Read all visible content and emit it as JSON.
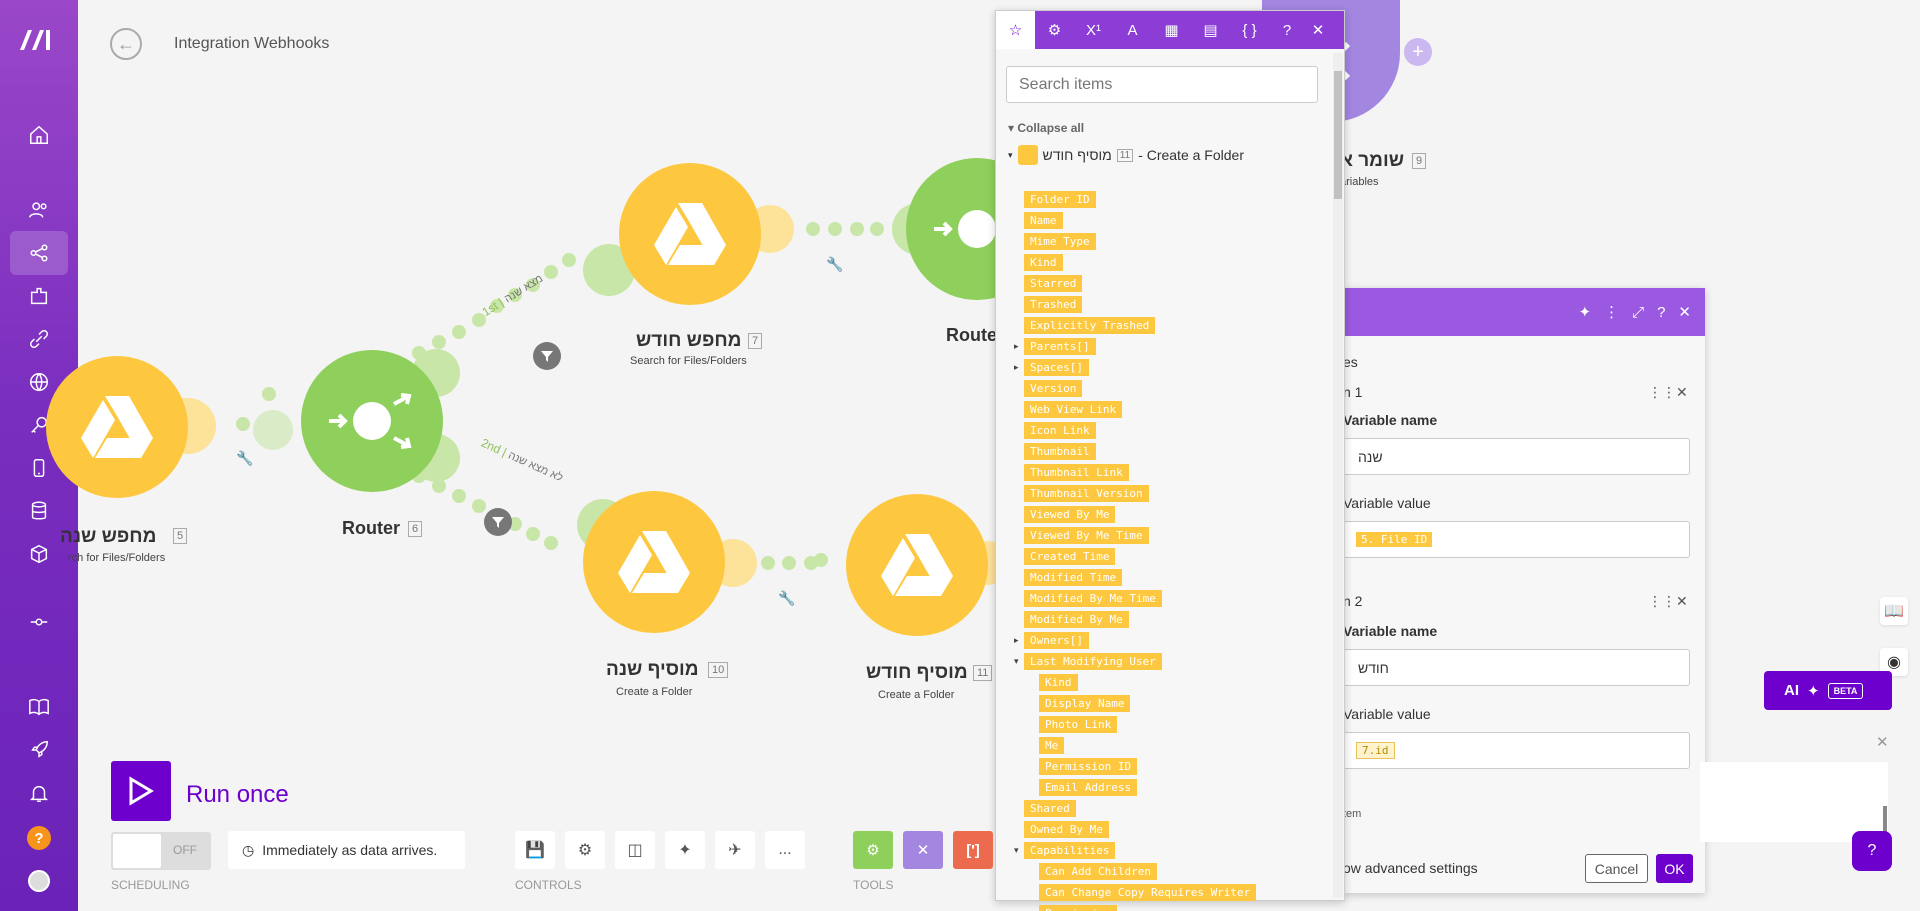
{
  "header": {
    "title": "Integration Webhooks"
  },
  "sidebar": {
    "items": [
      "home-icon",
      "team-icon",
      "scenarios-icon",
      "templates-icon",
      "connections-icon",
      "webhooks-icon",
      "keys-icon",
      "devices-icon",
      "datastores-icon",
      "datastructures-icon",
      "flow-control-icon",
      "docs-icon",
      "rocket-icon",
      "bell-icon"
    ],
    "help_label": "?"
  },
  "canvas": {
    "nodes": [
      {
        "id": "search-year",
        "label": "מחפש שנה",
        "num": "5",
        "sub": "rch for Files/Folders"
      },
      {
        "id": "router-1",
        "label": "Router",
        "num": "6"
      },
      {
        "id": "search-month",
        "label": "מחפש חודש",
        "num": "7",
        "sub": "Search for Files/Folders"
      },
      {
        "id": "router-2",
        "label": "Route"
      },
      {
        "id": "add-year",
        "label": "מוסיף שנה",
        "num": "10",
        "sub": "Create a Folder"
      },
      {
        "id": "add-month",
        "label": "מוסיף חודש",
        "num": "11",
        "sub": "Create a Folder"
      },
      {
        "id": "set-vars",
        "label": "שומר א",
        "num": "9",
        "sub": "ariables"
      }
    ],
    "routes": [
      {
        "order": "1st",
        "label": "מצא שנה"
      },
      {
        "order": "2nd",
        "label": "לא מצא שנה"
      }
    ]
  },
  "bottom": {
    "run_label": "Run once",
    "toggle_label": "OFF",
    "schedule_text": "Immediately as data arrives.",
    "scheduling_label": "SCHEDULING",
    "controls_label": "CONTROLS",
    "tools_label": "TOOLS",
    "more_label": "...",
    "tool_text_label": "[']"
  },
  "mapper": {
    "search_placeholder": "Search items",
    "collapse_all": "Collapse all",
    "root_label": "מוסיף חודש",
    "root_num": "11",
    "root_suffix": "- Create a Folder",
    "items": [
      {
        "label": "Folder ID",
        "indent": 0
      },
      {
        "label": "Name",
        "indent": 0
      },
      {
        "label": "Mime Type",
        "indent": 0
      },
      {
        "label": "Kind",
        "indent": 0
      },
      {
        "label": "Starred",
        "indent": 0
      },
      {
        "label": "Trashed",
        "indent": 0
      },
      {
        "label": "Explicitly Trashed",
        "indent": 0
      },
      {
        "label": "Parents[]",
        "indent": 0,
        "caret": "right"
      },
      {
        "label": "Spaces[]",
        "indent": 0,
        "caret": "right"
      },
      {
        "label": "Version",
        "indent": 0
      },
      {
        "label": "Web View Link",
        "indent": 0
      },
      {
        "label": "Icon Link",
        "indent": 0
      },
      {
        "label": "Thumbnail",
        "indent": 0
      },
      {
        "label": "Thumbnail Link",
        "indent": 0
      },
      {
        "label": "Thumbnail Version",
        "indent": 0
      },
      {
        "label": "Viewed By Me",
        "indent": 0
      },
      {
        "label": "Viewed By Me Time",
        "indent": 0
      },
      {
        "label": "Created Time",
        "indent": 0
      },
      {
        "label": "Modified Time",
        "indent": 0
      },
      {
        "label": "Modified By Me Time",
        "indent": 0
      },
      {
        "label": "Modified By Me",
        "indent": 0
      },
      {
        "label": "Owners[]",
        "indent": 0,
        "caret": "right"
      },
      {
        "label": "Last Modifying User",
        "indent": 0,
        "caret": "down"
      },
      {
        "label": "Kind",
        "indent": 1
      },
      {
        "label": "Display Name",
        "indent": 1
      },
      {
        "label": "Photo Link",
        "indent": 1
      },
      {
        "label": "Me",
        "indent": 1
      },
      {
        "label": "Permission ID",
        "indent": 1
      },
      {
        "label": "Email Address",
        "indent": 1
      },
      {
        "label": "Shared",
        "indent": 0
      },
      {
        "label": "Owned By Me",
        "indent": 0
      },
      {
        "label": "Capabilities",
        "indent": 0,
        "caret": "down"
      },
      {
        "label": "Can Add Children",
        "indent": 1
      },
      {
        "label": "Can Change Copy Requires Writer",
        "indent": 1
      },
      {
        "label": "Permission",
        "indent": 1
      }
    ]
  },
  "variables": {
    "section_label": "es",
    "item1_label": "n 1",
    "item2_label": "n 2",
    "name_label": "Variable name",
    "value_label": "Variable value",
    "var1_name": "שנה",
    "var1_value": "5. File ID",
    "var2_name": "חודש",
    "var2_value": "7.id",
    "add_item": "tem",
    "advanced": "ow advanced settings",
    "cancel": "Cancel",
    "ok": "OK"
  },
  "ai": {
    "label": "AI",
    "beta": "BETA"
  },
  "colors": {
    "accent": "#6d00cc",
    "yellow": "#fdc83f",
    "green": "#8fcf5c",
    "sidebar": "#7a2ebf"
  }
}
